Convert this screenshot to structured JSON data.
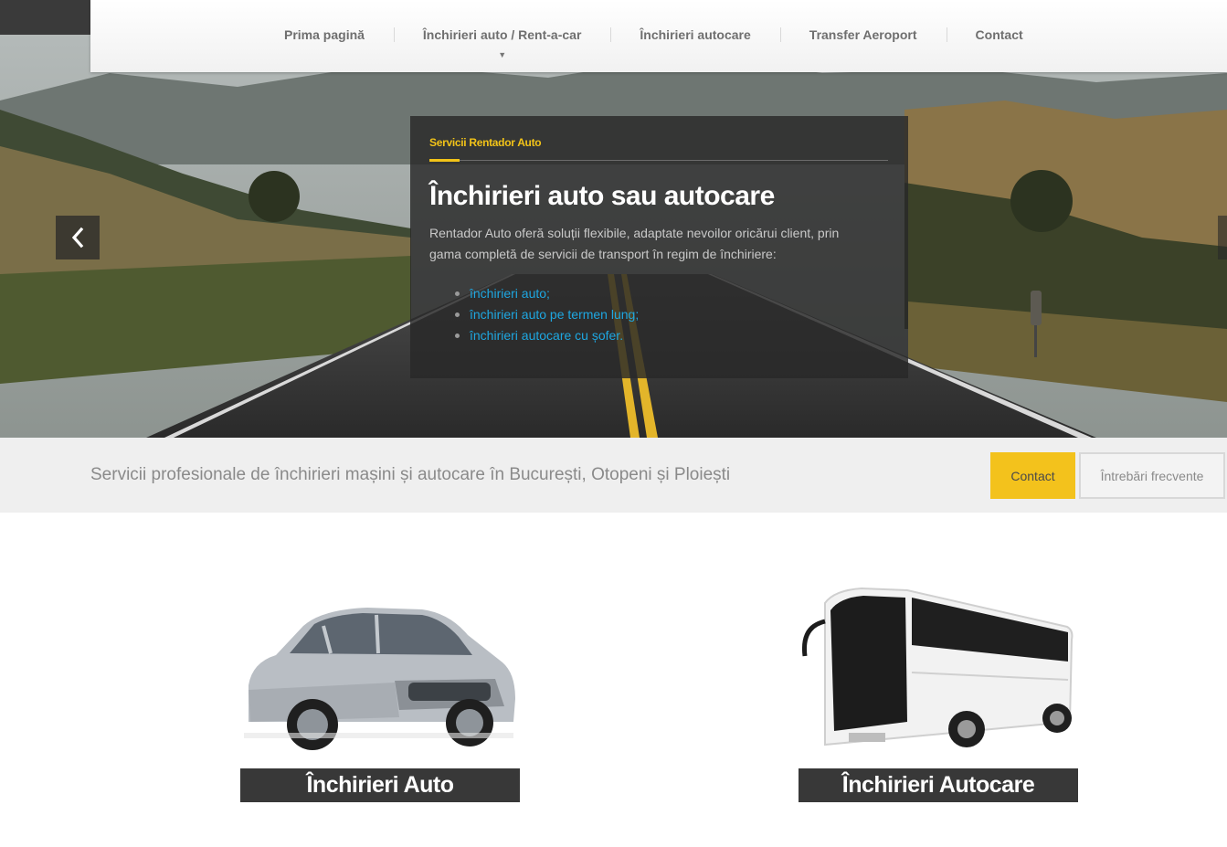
{
  "nav": {
    "items": [
      {
        "label": "Prima pagină"
      },
      {
        "label": "Închirieri auto / Rent-a-car",
        "has_dropdown": true
      },
      {
        "label": "Închirieri autocare"
      },
      {
        "label": "Transfer Aeroport"
      },
      {
        "label": "Contact"
      }
    ]
  },
  "hero": {
    "eyebrow": "Servicii Rentador Auto",
    "title": "Închirieri auto sau autocare",
    "text": "Rentador Auto oferă soluții flexibile, adaptate nevoilor oricărui client, prin gama completă de servicii de transport în regim de închiriere:",
    "links": [
      "închirieri auto;",
      "închirieri auto pe termen lung;",
      "închirieri autocare cu șofer."
    ],
    "prev_icon": "chevron-left-icon"
  },
  "bar": {
    "tagline": "Servicii profesionale de închirieri mașini și autocare în București, Otopeni și Ploiești",
    "contact_label": "Contact",
    "faq_label": "Întrebări frecvente"
  },
  "services": {
    "auto_label": "Închirieri Auto",
    "coach_label": "Închirieri Autocare"
  },
  "colors": {
    "accent": "#f3c21c",
    "link": "#1ea7e1",
    "dark": "#383838"
  }
}
